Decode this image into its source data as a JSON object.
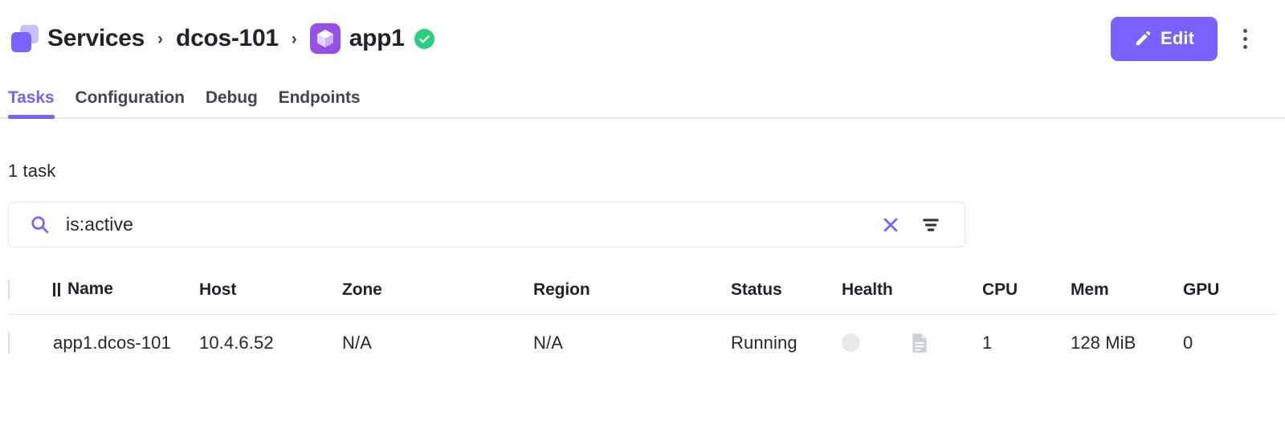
{
  "header": {
    "breadcrumb": [
      {
        "label": "Services",
        "icon": "services-stack-icon"
      },
      {
        "label": "dcos-101",
        "icon": null
      },
      {
        "label": "app1",
        "icon": "app-cube-icon"
      }
    ],
    "separator": "›",
    "status_icon": "check-circle-icon",
    "status_color": "#27cf7e",
    "edit_label": "Edit",
    "edit_icon": "pencil-icon",
    "edit_color": "#7b61ff",
    "more_icon": "kebab-menu-icon"
  },
  "tabs": [
    {
      "label": "Tasks",
      "active": true
    },
    {
      "label": "Configuration",
      "active": false
    },
    {
      "label": "Debug",
      "active": false
    },
    {
      "label": "Endpoints",
      "active": false
    }
  ],
  "accent_color": "#7b61ff",
  "main": {
    "task_count": "1 task",
    "search": {
      "value": "is:active",
      "placeholder": "Search",
      "search_icon": "search-icon",
      "clear_icon": "close-x-icon",
      "filter_icon": "filter-icon"
    },
    "table": {
      "columns": [
        {
          "key": "check",
          "label": "",
          "align": "left"
        },
        {
          "key": "name",
          "label": "Name",
          "align": "left",
          "sort_glyph": "II"
        },
        {
          "key": "host",
          "label": "Host",
          "align": "left"
        },
        {
          "key": "zone",
          "label": "Zone",
          "align": "left"
        },
        {
          "key": "region",
          "label": "Region",
          "align": "left"
        },
        {
          "key": "status",
          "label": "Status",
          "align": "left"
        },
        {
          "key": "health",
          "label": "Health",
          "align": "left"
        },
        {
          "key": "cpu",
          "label": "CPU",
          "align": "right"
        },
        {
          "key": "mem",
          "label": "Mem",
          "align": "right"
        },
        {
          "key": "gpu",
          "label": "GPU",
          "align": "right"
        }
      ],
      "rows": [
        {
          "name": "app1.dcos-101",
          "host": "10.4.6.52",
          "zone": "N/A",
          "region": "N/A",
          "status": "Running",
          "health": "health-dot-icon",
          "logs": "file-document-icon",
          "cpu": "1",
          "mem": "128 MiB",
          "gpu": "0"
        }
      ]
    }
  }
}
